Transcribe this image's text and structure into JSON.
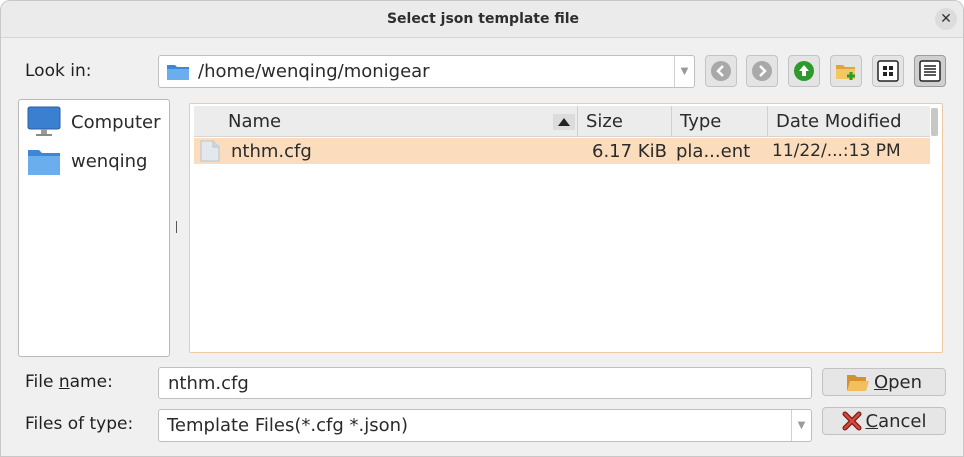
{
  "dialog": {
    "title": "Select json template file"
  },
  "look_in": {
    "label": "Look in:",
    "path": "/home/wenqing/monigear"
  },
  "toolbar": {
    "buttons": [
      {
        "name": "back-button",
        "icon": "arrow-left-icon"
      },
      {
        "name": "forward-button",
        "icon": "arrow-right-icon"
      },
      {
        "name": "parent-directory-button",
        "icon": "arrow-up-icon"
      },
      {
        "name": "new-folder-button",
        "icon": "new-folder-icon"
      },
      {
        "name": "list-view-button",
        "icon": "grid-icon"
      },
      {
        "name": "detail-view-button",
        "icon": "detail-list-icon"
      }
    ]
  },
  "sidebar": {
    "items": [
      {
        "label": "Computer",
        "icon": "computer-icon"
      },
      {
        "label": "wenqing",
        "icon": "folder-icon"
      }
    ]
  },
  "file_list": {
    "columns": [
      "Name",
      "Size",
      "Type",
      "Date Modified"
    ],
    "rows": [
      {
        "name": "nthm.cfg",
        "size": "6.17 KiB",
        "type": "pla...ent",
        "date": "11/22/...:13 PM",
        "selected": true
      }
    ]
  },
  "file_name": {
    "label_pre": "File ",
    "label_accel": "n",
    "label_post": "ame:",
    "value": "nthm.cfg"
  },
  "file_type": {
    "label": "Files of type:",
    "value": "Template Files(*.cfg *.json)"
  },
  "buttons": {
    "open_accel": "O",
    "open_rest": "pen",
    "cancel_accel": "C",
    "cancel_rest": "ancel"
  },
  "colors": {
    "selection": "#fbddbd",
    "accent_green": "#2e9a2e",
    "folder_blue": "#4a90d9"
  }
}
